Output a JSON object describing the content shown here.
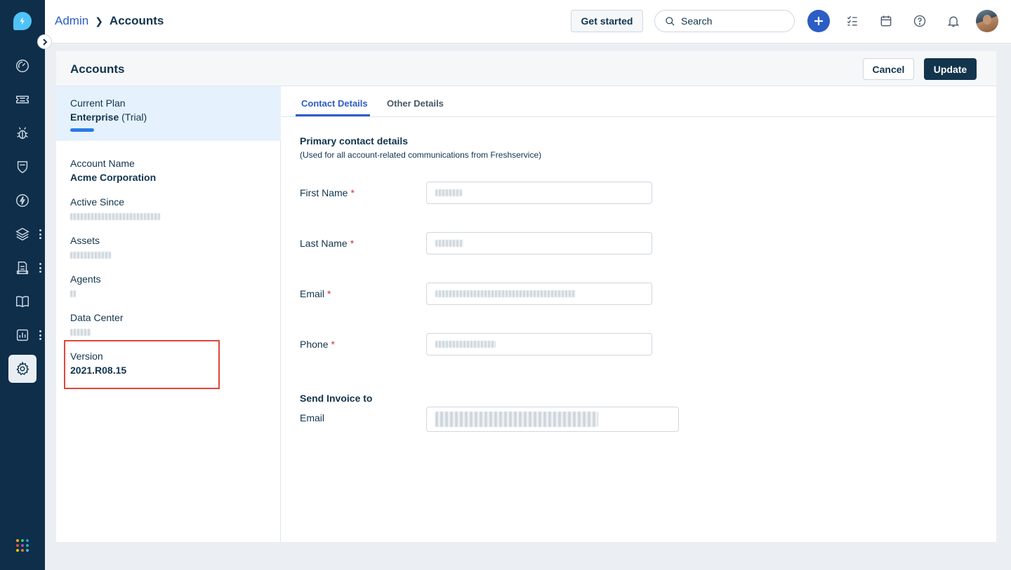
{
  "breadcrumb": {
    "parent": "Admin",
    "current": "Accounts"
  },
  "header": {
    "get_started": "Get started",
    "search_placeholder": "Search"
  },
  "page": {
    "title": "Accounts",
    "cancel": "Cancel",
    "update": "Update"
  },
  "plan": {
    "label": "Current Plan",
    "name": "Enterprise",
    "suffix": "(Trial)"
  },
  "account": {
    "name_label": "Account Name",
    "name_value": "Acme Corporation",
    "active_since_label": "Active Since",
    "assets_label": "Assets",
    "agents_label": "Agents",
    "data_center_label": "Data Center",
    "version_label": "Version",
    "version_value": "2021.R08.15"
  },
  "tabs": [
    {
      "label": "Contact Details",
      "active": true
    },
    {
      "label": "Other Details",
      "active": false
    }
  ],
  "contact": {
    "section_title": "Primary contact details",
    "section_sub": "(Used for all account-related communications from Freshservice)",
    "fields": [
      {
        "label": "First Name",
        "required": true
      },
      {
        "label": "Last Name",
        "required": true
      },
      {
        "label": "Email",
        "required": true
      },
      {
        "label": "Phone",
        "required": true
      }
    ],
    "required_mark": "*",
    "invoice_title": "Send Invoice to",
    "invoice_email_label": "Email"
  },
  "colors": {
    "nav_bg": "#0f2e4a",
    "primary": "#2c5cc5",
    "dark_button": "#12344d",
    "highlight_border": "#e0453a",
    "plan_bg": "#e5f2fd"
  },
  "icons": [
    "lightning-logo-icon",
    "dashboard-icon",
    "ticket-icon",
    "bug-icon",
    "shield-icon",
    "bolt-icon",
    "layers-icon",
    "inventory-icon",
    "book-icon",
    "reports-icon",
    "gear-icon",
    "apps-grid-icon",
    "search-icon",
    "plus-icon",
    "checklist-icon",
    "calendar-icon",
    "help-icon",
    "bell-icon"
  ]
}
